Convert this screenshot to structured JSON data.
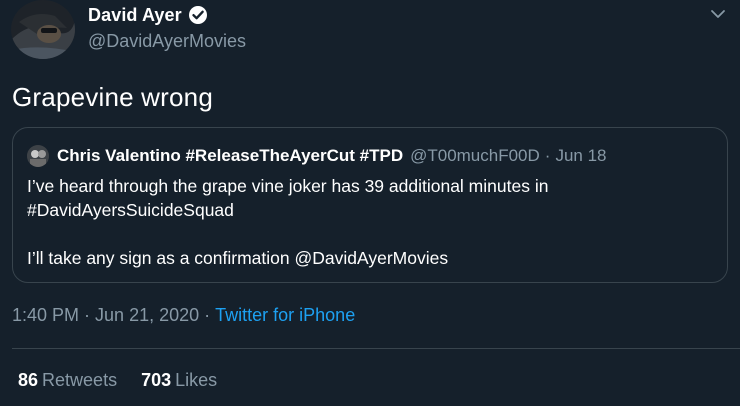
{
  "author": {
    "display_name": "David Ayer",
    "handle": "@DavidAyerMovies",
    "verified_icon": "verified-badge-icon",
    "avatar_icon": "avatar"
  },
  "tweet": {
    "text": "Grapevine wrong"
  },
  "quote": {
    "display_name": "Chris Valentino #ReleaseTheAyerCut #TPD",
    "handle": "@T00muchF00D",
    "separator": "·",
    "date": "Jun 18",
    "line1": "I’ve heard through the grape vine joker has 39 additional minutes in",
    "line2": "#DavidAyersSuicideSquad",
    "line3": "I’ll take any sign as a confirmation @DavidAyerMovies"
  },
  "meta": {
    "time": "1:40 PM",
    "separator": "·",
    "date": "Jun 21, 2020",
    "source": "Twitter for iPhone"
  },
  "stats": {
    "retweets_count": "86",
    "retweets_label": "Retweets",
    "likes_count": "703",
    "likes_label": "Likes"
  },
  "colors": {
    "background": "#15202b",
    "secondary_text": "#8899a6",
    "link": "#1da1f2",
    "border": "#38444d"
  }
}
